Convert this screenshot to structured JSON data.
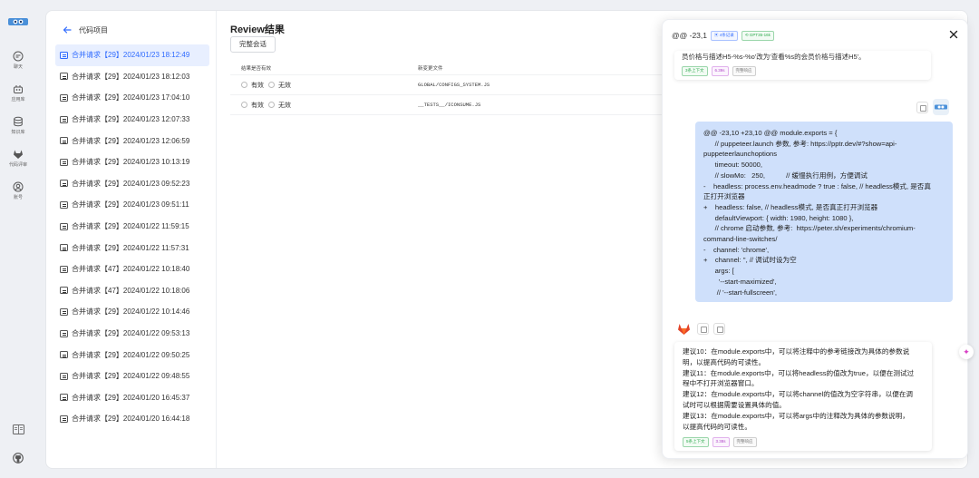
{
  "rail": {
    "items": [
      {
        "label": "聊天",
        "icon": "chat-icon"
      },
      {
        "label": "应用库",
        "icon": "robot-icon"
      },
      {
        "label": "知识库",
        "icon": "database-icon"
      },
      {
        "label": "代码评审",
        "icon": "gitlab-icon"
      },
      {
        "label": "账号",
        "icon": "user-icon"
      }
    ]
  },
  "project_list": {
    "title": "代码项目",
    "items": [
      {
        "label": "合并请求【29】2024/01/23 18:12:49",
        "active": true
      },
      {
        "label": "合并请求【29】2024/01/23 18:12:03"
      },
      {
        "label": "合并请求【29】2024/01/23 17:04:10"
      },
      {
        "label": "合并请求【29】2024/01/23 12:07:33"
      },
      {
        "label": "合并请求【29】2024/01/23 12:06:59"
      },
      {
        "label": "合并请求【29】2024/01/23 10:13:19"
      },
      {
        "label": "合并请求【29】2024/01/23 09:52:23"
      },
      {
        "label": "合并请求【29】2024/01/23 09:51:11"
      },
      {
        "label": "合并请求【29】2024/01/22 11:59:15"
      },
      {
        "label": "合并请求【29】2024/01/22 11:57:31"
      },
      {
        "label": "合并请求【47】2024/01/22 10:18:40"
      },
      {
        "label": "合并请求【47】2024/01/22 10:18:06"
      },
      {
        "label": "合并请求【29】2024/01/22 10:14:46"
      },
      {
        "label": "合并请求【29】2024/01/22 09:53:13"
      },
      {
        "label": "合并请求【29】2024/01/22 09:50:25"
      },
      {
        "label": "合并请求【29】2024/01/22 09:48:55"
      },
      {
        "label": "合并请求【29】2024/01/20 16:45:37"
      },
      {
        "label": "合并请求【29】2024/01/20 16:44:18"
      }
    ]
  },
  "review": {
    "title": "Review结果",
    "full_session_button": "完整会话",
    "columns": [
      "结果是否有效",
      "新变更文件"
    ],
    "valid_label": "有效",
    "invalid_label": "无效",
    "rows": [
      {
        "file": "GLOBAL/CONFIGS_SYSTEM.JS"
      },
      {
        "file": "__TESTS__/ICONSUME.JS"
      }
    ]
  },
  "drawer": {
    "title": "@@ -23,1",
    "tag_records": "4条记录",
    "tag_model": "GPT35-16k",
    "top_message": "员价格与描述H5-%s-%o'改为'查看%s的会员价格与描述H5'。",
    "top_tags": [
      "3条上下文",
      "6.39s",
      "完整响应"
    ],
    "user_message_lines": [
      "@@ -23,10 +23,10 @@ module.exports = {",
      "      // puppeteer.launch 参数, 参考: https://pptr.dev/#?show=api-",
      "puppeteerlaunchoptions",
      "      timeout: 50000,",
      "      // slowMo:   250,           // 缓慢执行用例，方便调试",
      "-    headless: process.env.headmode ? true : false, // headless模式, 是否真",
      "正打开浏览器",
      "+    headless: false, // headless模式, 是否真正打开浏览器",
      "      defaultViewport: { width: 1980, height: 1080 },",
      "      // chrome 启动参数, 参考:  https://peter.sh/experiments/chromium-",
      "command-line-switches/",
      "-    channel: 'chrome',",
      "+    channel: '', // 调试时设为空",
      "      args: [",
      "        '--start-maximized',",
      "       // '--start-fullscreen',"
    ],
    "bot_message_lines": [
      "建议10：在module.exports中，可以将注释中的参考链接改为具体的参数说",
      "明，以提高代码的可读性。",
      "建议11：在module.exports中，可以将headless的值改为true，以便在测试过",
      "程中不打开浏览器窗口。",
      "建议12：在module.exports中，可以将channel的值改为空字符串，以便在调",
      "试时可以根据需要设置具体的值。",
      "建议13：在module.exports中，可以将args中的注释改为具体的参数说明，",
      "以提高代码的可读性。"
    ],
    "bot_tags": [
      "5条上下文",
      "3.38s",
      "完整响应"
    ]
  }
}
